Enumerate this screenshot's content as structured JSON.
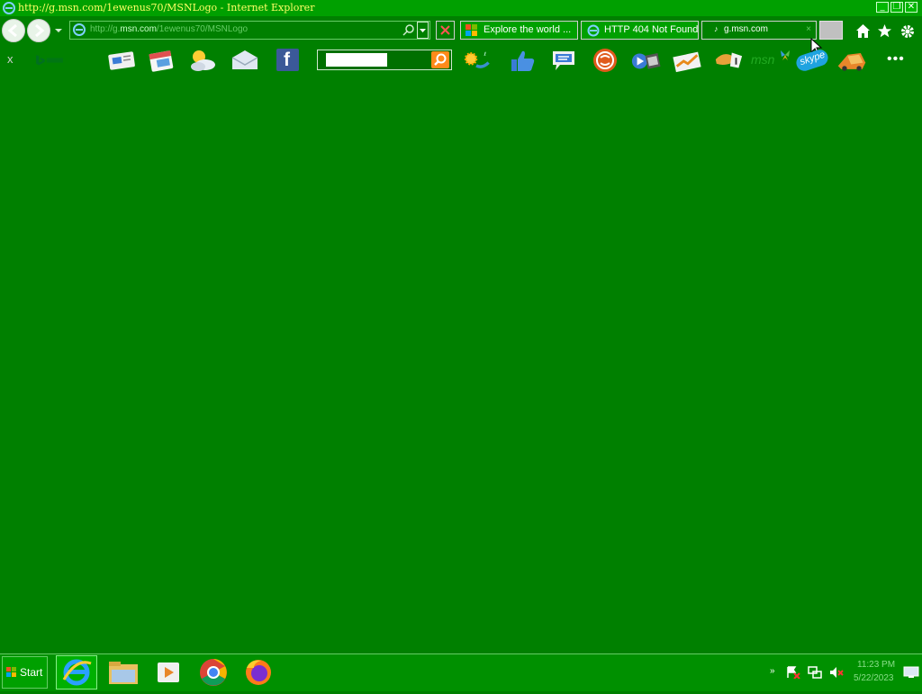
{
  "window": {
    "title": "http://g.msn.com/1ewenus70/MSNLogo - Internet Explorer",
    "minimize_label": "_",
    "restore_label": "❐",
    "close_label": "✕"
  },
  "address": {
    "prefix": "http://g.",
    "domain": "msn.com",
    "path": "/1ewenus70/MSNLogo"
  },
  "tabs": [
    {
      "label": "Explore the world ...",
      "icon": "windows-logo-icon"
    },
    {
      "label": "HTTP 404 Not Found",
      "icon": "ie-icon"
    },
    {
      "label": "g.msn.com",
      "icon": "loading-icon"
    }
  ],
  "toolbar": {
    "close_label": "x",
    "icons": [
      "bing-icon",
      "news-icon",
      "calendar-icon",
      "weather-icon",
      "mail-icon",
      "facebook-icon",
      "search-input",
      "weather-sun-icon",
      "like-icon",
      "chat-icon",
      "music-icon",
      "video-icon",
      "money-icon",
      "sports-icon",
      "msn-icon",
      "skype-icon",
      "autos-icon",
      "more-icon"
    ],
    "facebook_letter": "f",
    "msn_label": "msn",
    "skype_label": "skype",
    "more_label": "•••"
  },
  "taskbar": {
    "start_label": "Start",
    "time": "11:23 PM",
    "date": "5/22/2023",
    "apps": [
      "internet-explorer",
      "file-explorer",
      "media-player",
      "chrome",
      "firefox"
    ]
  },
  "colors": {
    "background": "#008000",
    "title_text": "#ffff66",
    "search_button": "#ff8a1a"
  }
}
